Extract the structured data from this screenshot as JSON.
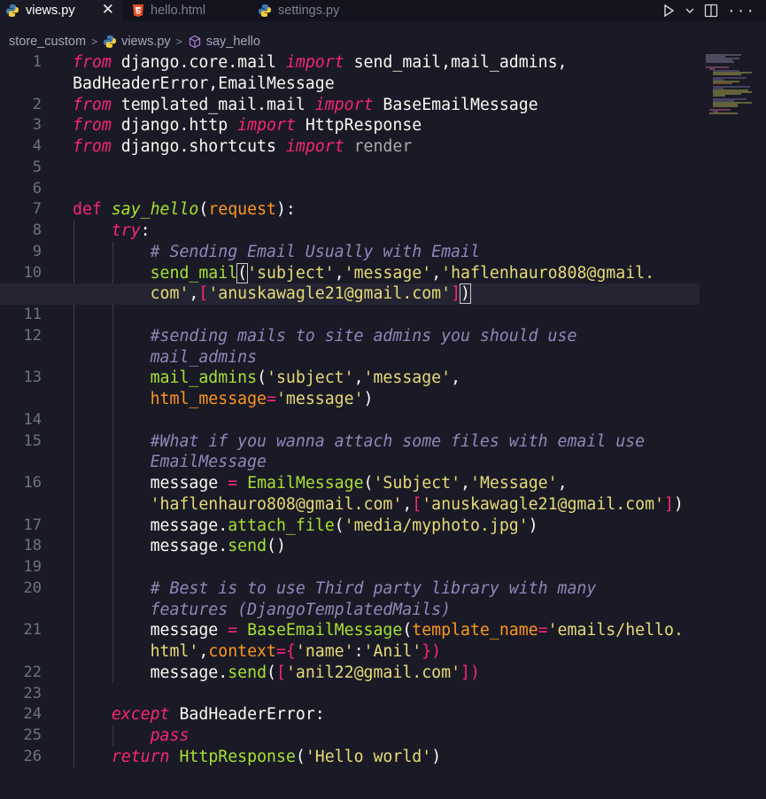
{
  "tabs": [
    {
      "label": "views.py",
      "active": true,
      "icon": "python-icon"
    },
    {
      "label": "hello.html",
      "active": false,
      "icon": "html5-icon"
    },
    {
      "label": "settings.py",
      "active": false,
      "icon": "python-icon"
    }
  ],
  "close_glyph": "✕",
  "breadcrumb": {
    "folder": "store_custom",
    "file": "views.py",
    "symbol": "say_hello"
  },
  "line_numbers": [
    "1",
    "2",
    "3",
    "4",
    "5",
    "6",
    "7",
    "8",
    "9",
    "10",
    "11",
    "12",
    "13",
    "14",
    "15",
    "16",
    "17",
    "18",
    "19",
    "20",
    "21",
    "22",
    "23",
    "24",
    "25",
    "26"
  ],
  "code": {
    "l1_from": "from",
    "l1_mod": " django.core.mail ",
    "l1_import": "import",
    "l1_rest": " send_mail,mail_admins,",
    "l1b": "BadHeaderError,EmailMessage",
    "l2_from": "from",
    "l2_mod": " templated_mail.mail ",
    "l2_import": "import",
    "l2_rest": " BaseEmailMessage",
    "l3_from": "from",
    "l3_mod": " django.http ",
    "l3_import": "import",
    "l3_rest": " HttpResponse",
    "l4_from": "from",
    "l4_mod": " django.shortcuts ",
    "l4_import": "import",
    "l4_rest": " render",
    "l7_def": "def",
    "l7_name": "say_hello",
    "l7_open": "(",
    "l7_param": "request",
    "l7_close": "):",
    "l8_try": "try",
    "l8_colon": ":",
    "l9_comment": "# Sending Email Usually with Email",
    "l10_fn": "send_mail",
    "l10_p": "(",
    "l10_s1": "'subject'",
    "l10_c1": ",",
    "l10_s2": "'message'",
    "l10_c2": ",",
    "l10_s3": "'haflenhauro808@gmail.",
    "l10b_s3": "com'",
    "l10b_c": ",",
    "l10b_b1": "[",
    "l10b_s4": "'anuskawagle21@gmail.com'",
    "l10b_b2": "]",
    "l10b_p": ")",
    "l12_comment": "#sending mails to site admins you should use",
    "l12b_comment": "mail_admins",
    "l13_fn": "mail_admins",
    "l13_p": "(",
    "l13_s1": "'subject'",
    "l13_c": ",",
    "l13_s2": "'message'",
    "l13_c2": ",",
    "l13b_kw": "html_message",
    "l13b_eq": "=",
    "l13b_s": "'message'",
    "l13b_p": ")",
    "l15_comment": "#What if you wanna attach some files with email use",
    "l15b_comment": "EmailMessage",
    "l16_var": "message ",
    "l16_eq": "=",
    "l16_fn": " EmailMessage",
    "l16_p": "(",
    "l16_s1": "'Subject'",
    "l16_c": ",",
    "l16_s2": "'Message'",
    "l16_c2": ",",
    "l16b_s1": "'haflenhauro808@gmail.com'",
    "l16b_c": ",",
    "l16b_b1": "[",
    "l16b_s2": "'anuskawagle21@gmail.com'",
    "l16b_b2": "]",
    "l16b_p": ")",
    "l17_var": "message.",
    "l17_fn": "attach_file",
    "l17_p": "(",
    "l17_s": "'media/myphoto.jpg'",
    "l17_p2": ")",
    "l18_var": "message.",
    "l18_fn": "send",
    "l18_p": "()",
    "l20_comment": "# Best is to use Third party library with many",
    "l20b_comment": "features (DjangoTemplatedMails)",
    "l21_var": "message ",
    "l21_eq": "=",
    "l21_fn": " BaseEmailMessage",
    "l21_p": "(",
    "l21_kw": "template_name",
    "l21_eq2": "=",
    "l21_s": "'emails/hello.",
    "l21b_s": "html'",
    "l21b_c": ",",
    "l21b_kw": "context",
    "l21b_eq": "=",
    "l21b_b": "{",
    "l21b_k": "'name'",
    "l21b_col": ":",
    "l21b_v": "'Anil'",
    "l21b_e": "})",
    "l22_var": "message.",
    "l22_fn": "send",
    "l22_p": "(",
    "l22_b": "[",
    "l22_s": "'anil22@gmail.com'",
    "l22_e": "])",
    "l24_kw": "except",
    "l24_cls": " BadHeaderError:",
    "l25_kw": "pass",
    "l26_kw": "return",
    "l26_fn": " HttpResponse",
    "l26_p": "(",
    "l26_s": "'Hello world'",
    "l26_e": ")"
  }
}
